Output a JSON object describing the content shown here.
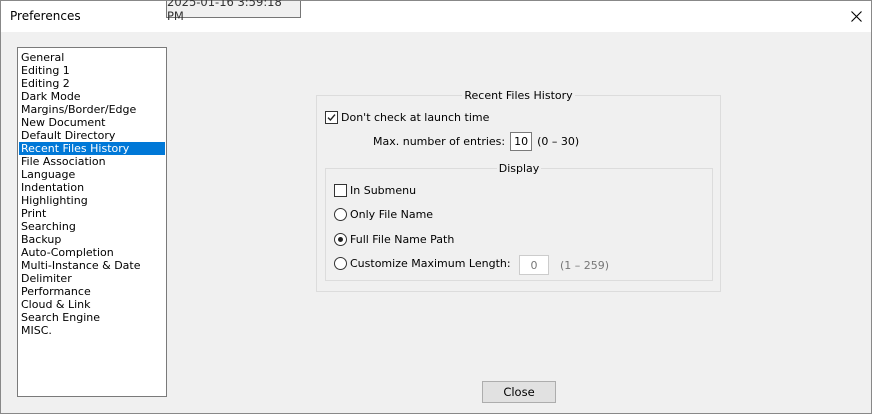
{
  "window": {
    "title": "Preferences",
    "tooltip": "2025-01-16 3:59:18 PM"
  },
  "sidebar": {
    "selected_index": 7,
    "items": [
      "General",
      "Editing 1",
      "Editing 2",
      "Dark Mode",
      "Margins/Border/Edge",
      "New Document",
      "Default Directory",
      "Recent Files History",
      "File Association",
      "Language",
      "Indentation",
      "Highlighting",
      "Print",
      "Searching",
      "Backup",
      "Auto-Completion",
      "Multi-Instance & Date",
      "Delimiter",
      "Performance",
      "Cloud & Link",
      "Search Engine",
      "MISC."
    ]
  },
  "recent": {
    "group_title": "Recent Files History",
    "dont_check_label": "Don't check at launch time",
    "dont_check_checked": true,
    "max_entries_label": "Max. number of entries:",
    "max_entries_value": "10",
    "max_entries_range": "(0 – 30)",
    "display": {
      "group_title": "Display",
      "in_submenu_label": "In Submenu",
      "in_submenu_checked": false,
      "only_file_name_label": "Only File Name",
      "full_path_label": "Full File Name Path",
      "customize_label": "Customize Maximum Length:",
      "customize_value": "0",
      "customize_range": "(1 – 259)",
      "selected_option": "full_path"
    }
  },
  "footer": {
    "close_label": "Close"
  },
  "colors": {
    "selection": "#0078d7",
    "window_bg": "#f0f0f0"
  }
}
